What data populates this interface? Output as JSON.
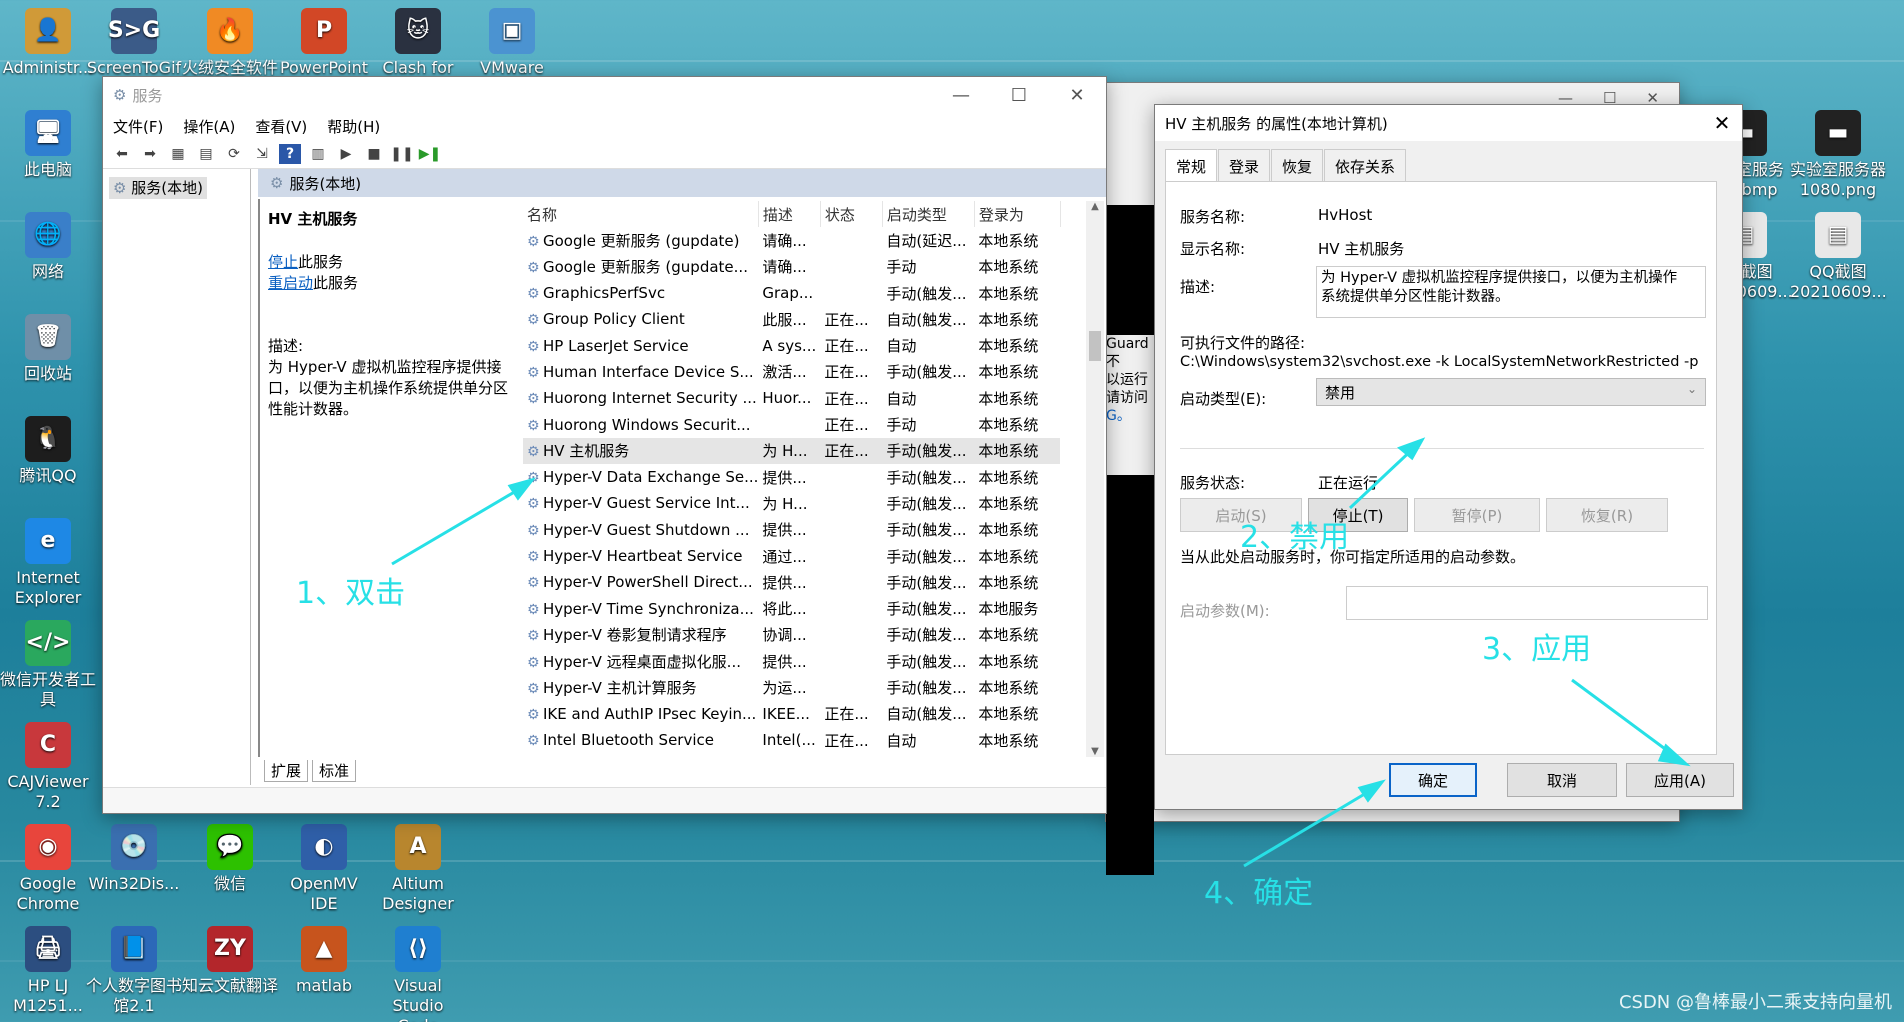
{
  "desktop_icons": [
    {
      "label": "Administr...",
      "color": "#d09a38",
      "glyph": "👤"
    },
    {
      "label": "ScreenToGif",
      "color": "#3b5b88",
      "glyph": "S>G"
    },
    {
      "label": "火绒安全软件",
      "color": "#f08a24",
      "glyph": "🔥"
    },
    {
      "label": "PowerPoint",
      "color": "#d24726",
      "glyph": "P"
    },
    {
      "label": "Clash for",
      "color": "#2a3140",
      "glyph": "🐱"
    },
    {
      "label": "VMware",
      "color": "#4b93d1",
      "glyph": "▣"
    },
    {
      "label": "此电脑",
      "color": "#2f7fd1",
      "glyph": "🖥"
    },
    {
      "label": "网络",
      "color": "#3a7fc9",
      "glyph": "🌐"
    },
    {
      "label": "回收站",
      "color": "#6f8fa8",
      "glyph": "🗑"
    },
    {
      "label": "腾讯QQ",
      "color": "#1d1d1d",
      "glyph": "🐧"
    },
    {
      "label": "Internet Explorer",
      "color": "#1e88e5",
      "glyph": "e"
    },
    {
      "label": "微信开发者工具",
      "color": "#2aa85e",
      "glyph": "</>"
    },
    {
      "label": "CAJViewer 7.2",
      "color": "#c8383c",
      "glyph": "C"
    },
    {
      "label": "Google Chrome",
      "color": "#e8453c",
      "glyph": "◉"
    },
    {
      "label": "Win32Dis...",
      "color": "#3a6fb0",
      "glyph": "💿"
    },
    {
      "label": "微信",
      "color": "#2dc100",
      "glyph": "💬"
    },
    {
      "label": "OpenMV IDE",
      "color": "#2f5fa8",
      "glyph": "◐"
    },
    {
      "label": "Altium Designer",
      "color": "#b8862e",
      "glyph": "A"
    },
    {
      "label": "HP LJ M1251...",
      "color": "#2c4e80",
      "glyph": "🖨"
    },
    {
      "label": "个人数字图书馆2.1",
      "color": "#2c68b8",
      "glyph": "📘"
    },
    {
      "label": "知云文献翻译",
      "color": "#b3262b",
      "glyph": "ZY"
    },
    {
      "label": "matlab",
      "color": "#c7541d",
      "glyph": "▲"
    },
    {
      "label": "Visual Studio Code",
      "color": "#1f7fd0",
      "glyph": "⟨⟩"
    },
    {
      "label": "实验室服务器...bmp",
      "color": "#222222",
      "glyph": "▬"
    },
    {
      "label": "实验室服务器1080.png",
      "color": "#222222",
      "glyph": "▬"
    },
    {
      "label": "QQ截图20210609...",
      "color": "#e8e8e8",
      "glyph": "▤"
    },
    {
      "label": "QQ截图20210609...",
      "color": "#e8e8e8",
      "glyph": "▤"
    }
  ],
  "services": {
    "title": "服务",
    "menu": [
      "文件(F)",
      "操作(A)",
      "查看(V)",
      "帮助(H)"
    ],
    "tree_item": "服务(本地)",
    "panel_head": "服务(本地)",
    "selected_service": "HV 主机服务",
    "stop_link": "停止",
    "stop_suffix": "此服务",
    "restart_link": "重启动",
    "restart_suffix": "此服务",
    "desc_label": "描述:",
    "desc_text": "为 Hyper-V 虚拟机监控程序提供接口，以便为主机操作系统提供单分区性能计数器。",
    "columns": [
      "名称",
      "描述",
      "状态",
      "启动类型",
      "登录为"
    ],
    "rows": [
      [
        "Google 更新服务 (gupdate)",
        "请确...",
        "",
        "自动(延迟...",
        "本地系统"
      ],
      [
        "Google 更新服务 (gupdate...",
        "请确...",
        "",
        "手动",
        "本地系统"
      ],
      [
        "GraphicsPerfSvc",
        "Grap...",
        "",
        "手动(触发...",
        "本地系统"
      ],
      [
        "Group Policy Client",
        "此服...",
        "正在...",
        "自动(触发...",
        "本地系统"
      ],
      [
        "HP LaserJet Service",
        "A sys...",
        "正在...",
        "自动",
        "本地系统"
      ],
      [
        "Human Interface Device S...",
        "激活...",
        "正在...",
        "手动(触发...",
        "本地系统"
      ],
      [
        "Huorong Internet Security ...",
        "Huor...",
        "正在...",
        "自动",
        "本地系统"
      ],
      [
        "Huorong Windows Securit...",
        "",
        "正在...",
        "手动",
        "本地系统"
      ],
      [
        "HV 主机服务",
        "为 H...",
        "正在...",
        "手动(触发...",
        "本地系统"
      ],
      [
        "Hyper-V Data Exchange Se...",
        "提供...",
        "",
        "手动(触发...",
        "本地系统"
      ],
      [
        "Hyper-V Guest Service Int...",
        "为 H...",
        "",
        "手动(触发...",
        "本地系统"
      ],
      [
        "Hyper-V Guest Shutdown ...",
        "提供...",
        "",
        "手动(触发...",
        "本地系统"
      ],
      [
        "Hyper-V Heartbeat Service",
        "通过...",
        "",
        "手动(触发...",
        "本地系统"
      ],
      [
        "Hyper-V PowerShell Direct...",
        "提供...",
        "",
        "手动(触发...",
        "本地系统"
      ],
      [
        "Hyper-V Time Synchroniza...",
        "将此...",
        "",
        "手动(触发...",
        "本地服务"
      ],
      [
        "Hyper-V 卷影复制请求程序",
        "协调...",
        "",
        "手动(触发...",
        "本地系统"
      ],
      [
        "Hyper-V 远程桌面虚拟化服...",
        "提供...",
        "",
        "手动(触发...",
        "本地系统"
      ],
      [
        "Hyper-V 主机计算服务",
        "为运...",
        "",
        "手动(触发...",
        "本地系统"
      ],
      [
        "IKE and AuthIP IPsec Keyin...",
        "IKEE...",
        "正在...",
        "自动(触发...",
        "本地系统"
      ],
      [
        "Intel Bluetooth Service",
        "Intel(...",
        "正在...",
        "自动",
        "本地系统"
      ]
    ],
    "bottom_tabs": [
      "扩展",
      "标准"
    ]
  },
  "background_window": {
    "text_lines": [
      "Guard 不",
      "以运行",
      "请访问",
      "G。"
    ],
    "confirm": "确定"
  },
  "dialog": {
    "title": "HV 主机服务 的属性(本地计算机)",
    "tabs": [
      "常规",
      "登录",
      "恢复",
      "依存关系"
    ],
    "service_name_label": "服务名称:",
    "service_name": "HvHost",
    "display_name_label": "显示名称:",
    "display_name": "HV 主机服务",
    "desc_label": "描述:",
    "desc": "为 Hyper-V 虚拟机监控程序提供接口，以便为主机操作系统提供单分区性能计数器。",
    "path_label": "可执行文件的路径:",
    "path": "C:\\Windows\\system32\\svchost.exe -k LocalSystemNetworkRestricted -p",
    "startup_type_label": "启动类型(E):",
    "startup_type": "禁用",
    "status_label": "服务状态:",
    "status": "正在运行",
    "btn_start": "启动(S)",
    "btn_stop": "停止(T)",
    "btn_pause": "暂停(P)",
    "btn_resume": "恢复(R)",
    "hint": "当从此处启动服务时，你可指定所适用的启动参数。",
    "params_label": "启动参数(M):",
    "params_value": "",
    "ok": "确定",
    "cancel": "取消",
    "apply": "应用(A)"
  },
  "annotations": {
    "step1": "1、双击",
    "step2": "2、禁用",
    "step3": "3、应用",
    "step4": "4、确定",
    "color": "#27e0e6"
  },
  "watermark": "CSDN @鲁棒最小二乘支持向量机"
}
